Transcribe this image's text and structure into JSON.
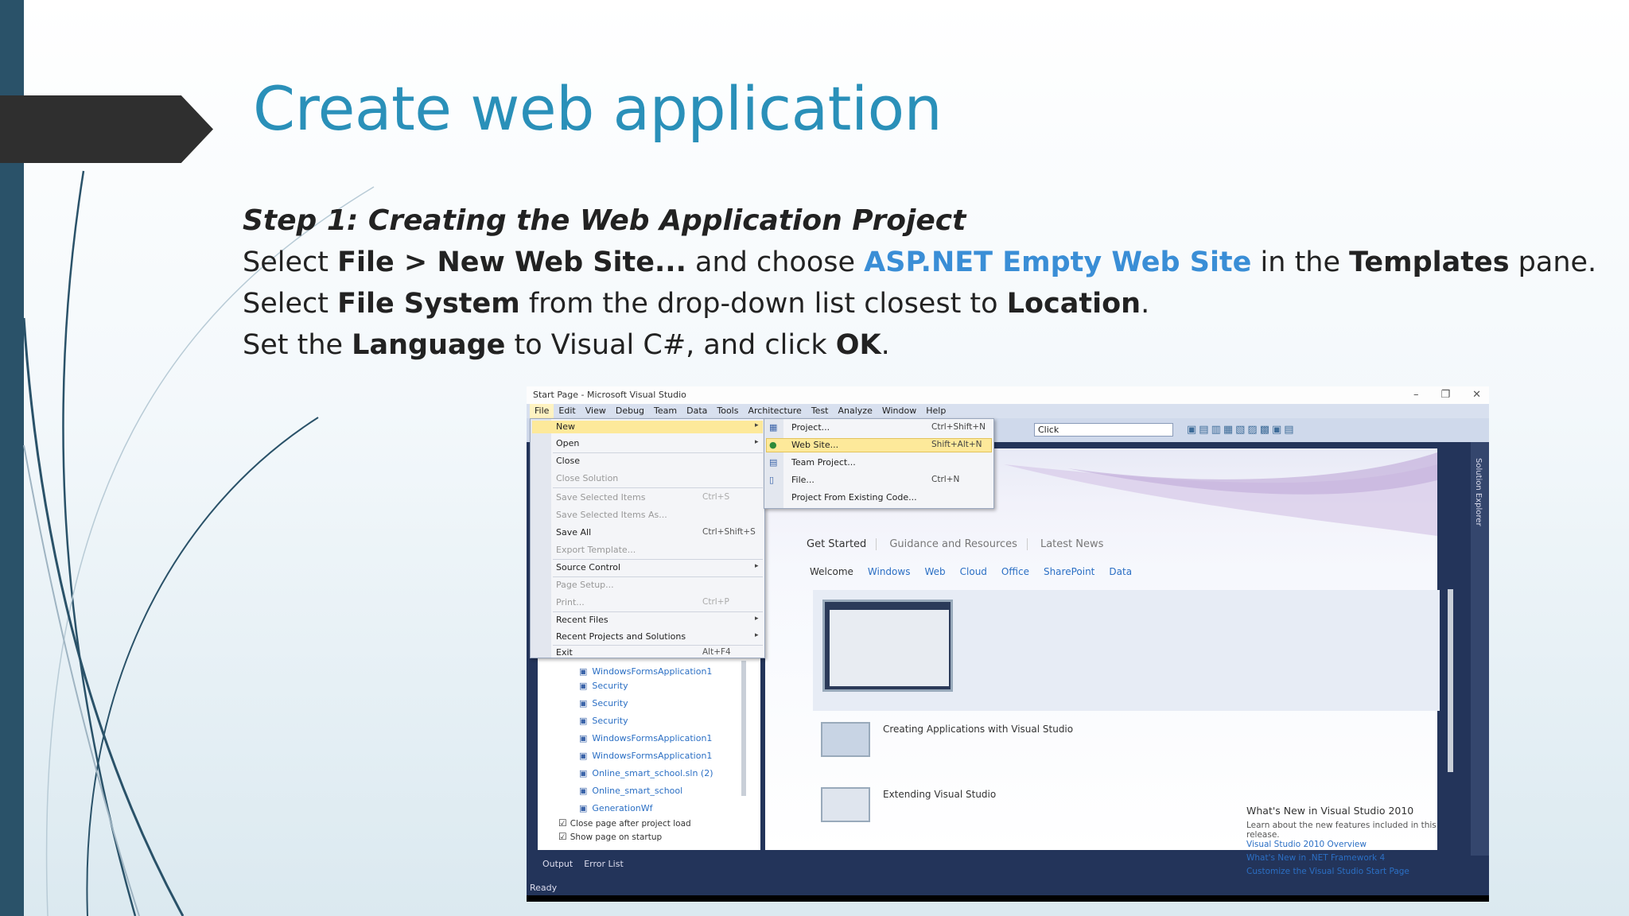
{
  "slide": {
    "title": "Create web application",
    "step_heading": "Step 1: Creating the Web Application Project",
    "line1": {
      "a": "Select ",
      "b": "File > New Web Site...",
      "c": " and choose ",
      "d": "ASP.NET Empty Web Site",
      "e": " in the ",
      "f": "Templates",
      "g": " pane."
    },
    "line2": {
      "a": "Select ",
      "b": "File System",
      "c": " from the drop-down list closest to ",
      "d": "Location",
      "e": "."
    },
    "line3": {
      "a": "Set the ",
      "b": "Language",
      "c": " to Visual C#, and click ",
      "d": "OK",
      "e": "."
    }
  },
  "colors": {
    "title": "#2a90b9",
    "highlight": "#3a8ed6",
    "left_bar": "#2a5269"
  },
  "vs": {
    "window_title": "Start Page - Microsoft Visual Studio",
    "window_controls": [
      "–",
      "❐",
      "✕"
    ],
    "menu": [
      "File",
      "Edit",
      "View",
      "Debug",
      "Team",
      "Data",
      "Tools",
      "Architecture",
      "Test",
      "Analyze",
      "Window",
      "Help"
    ],
    "toolbar_combo": "Click",
    "file_menu": [
      {
        "label": "New",
        "shortcut": "",
        "arrow": true,
        "dim": false
      },
      {
        "label": "Open",
        "shortcut": "",
        "arrow": true,
        "dim": false
      },
      {
        "label": "Close",
        "shortcut": "",
        "arrow": false,
        "dim": false
      },
      {
        "label": "Close Solution",
        "shortcut": "",
        "arrow": false,
        "dim": true
      },
      {
        "label": "Save Selected Items",
        "shortcut": "Ctrl+S",
        "arrow": false,
        "dim": true
      },
      {
        "label": "Save Selected Items As...",
        "shortcut": "",
        "arrow": false,
        "dim": true
      },
      {
        "label": "Save All",
        "shortcut": "Ctrl+Shift+S",
        "arrow": false,
        "dim": false
      },
      {
        "label": "Export Template...",
        "shortcut": "",
        "arrow": false,
        "dim": true
      },
      {
        "label": "Source Control",
        "shortcut": "",
        "arrow": true,
        "dim": false
      },
      {
        "label": "Page Setup...",
        "shortcut": "",
        "arrow": false,
        "dim": true
      },
      {
        "label": "Print...",
        "shortcut": "Ctrl+P",
        "arrow": false,
        "dim": true
      },
      {
        "label": "Recent Files",
        "shortcut": "",
        "arrow": true,
        "dim": false
      },
      {
        "label": "Recent Projects and Solutions",
        "shortcut": "",
        "arrow": true,
        "dim": false
      },
      {
        "label": "Exit",
        "shortcut": "Alt+F4",
        "arrow": false,
        "dim": false
      }
    ],
    "new_submenu": [
      {
        "label": "Project...",
        "shortcut": "Ctrl+Shift+N"
      },
      {
        "label": "Web Site...",
        "shortcut": "Shift+Alt+N"
      },
      {
        "label": "Team Project...",
        "shortcut": ""
      },
      {
        "label": "File...",
        "shortcut": "Ctrl+N"
      },
      {
        "label": "Project From Existing Code...",
        "shortcut": ""
      }
    ],
    "tabs": [
      "Get Started",
      "Guidance and Resources",
      "Latest News"
    ],
    "subtabs": [
      "Welcome",
      "Windows",
      "Web",
      "Cloud",
      "Office",
      "SharePoint",
      "Data"
    ],
    "card": {
      "title": "What's New in Visual Studio 2010",
      "lead": "Learn about the new features included in this release.",
      "links": [
        "Visual Studio 2010 Overview",
        "What's New in .NET Framework 4",
        "Customize the Visual Studio Start Page"
      ]
    },
    "item2": "Creating Applications with Visual Studio",
    "item3": "Extending Visual Studio",
    "recent_projects": [
      "WindowsFormsApplication1",
      "Security",
      "Security",
      "Security",
      "WindowsFormsApplication1",
      "WindowsFormsApplication1",
      "Online_smart_school.sln (2)",
      "Online_smart_school",
      "GenerationWf"
    ],
    "checks": [
      "Close page after project load",
      "Show page on startup"
    ],
    "right_tab": "Solution Explorer",
    "bottom_tabs": [
      "Output",
      "Error List"
    ],
    "status": "Ready"
  }
}
